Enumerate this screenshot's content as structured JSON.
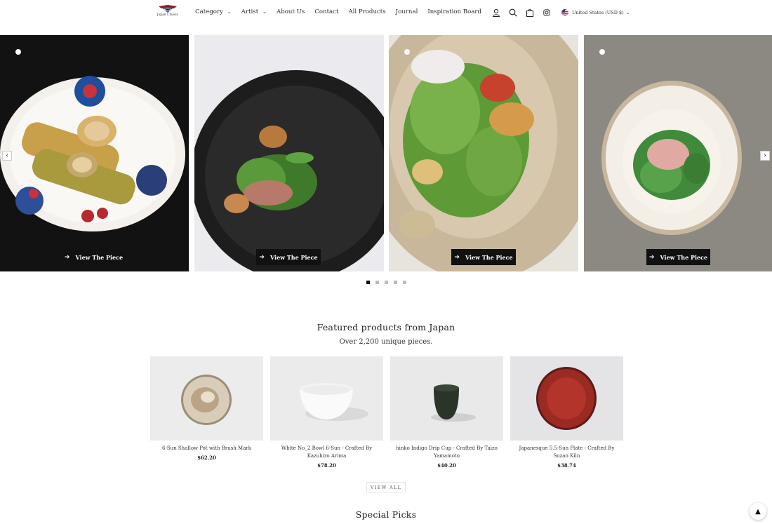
{
  "brand": {
    "logo_text": "Japan Classic"
  },
  "nav": {
    "items": [
      {
        "label": "Category",
        "has_dropdown": true
      },
      {
        "label": "Artist",
        "has_dropdown": true
      },
      {
        "label": "About Us",
        "has_dropdown": false
      },
      {
        "label": "Contact",
        "has_dropdown": false
      },
      {
        "label": "All Products",
        "has_dropdown": false
      },
      {
        "label": "Journal",
        "has_dropdown": false
      },
      {
        "label": "Inspiration Board",
        "has_dropdown": false
      }
    ]
  },
  "header_icons": [
    "account-icon",
    "search-icon",
    "cart-icon",
    "instagram-icon"
  ],
  "currency": {
    "label": "United States (USD $)"
  },
  "carousel": {
    "button_label": "View The Piece",
    "slides": [
      {
        "name": "spring-rolls-on-floral-plate"
      },
      {
        "name": "salad-on-black-plate"
      },
      {
        "name": "green-salad-on-beige-plate"
      },
      {
        "name": "greens-on-white-bowl"
      }
    ],
    "pages": 5,
    "active_page": 0
  },
  "featured": {
    "title": "Featured products from Japan",
    "subtitle": "Over 2,200 unique pieces.",
    "products": [
      {
        "name": "6-Sun Shallow Pot with Brush Mark",
        "price": "$62.20"
      },
      {
        "name": "White No_2 Bowl 6-Sun - Crafted By Kazuhiro Arima",
        "price": "$78.20"
      },
      {
        "name": "hinko Indigo Drip Cup - Crafted By Taizo Yamamoto",
        "price": "$40.20"
      },
      {
        "name": "Japanesque 5.5-Sun Plate - Crafted By Sozan Kiln",
        "price": "$38.74"
      }
    ],
    "view_all_label": "VIEW ALL"
  },
  "special": {
    "title": "Special Picks"
  },
  "scroll_top": {
    "glyph": "▲"
  },
  "colors": {
    "button_bg": "#111111",
    "text": "#2b2b2b",
    "background": "#ffffff"
  }
}
